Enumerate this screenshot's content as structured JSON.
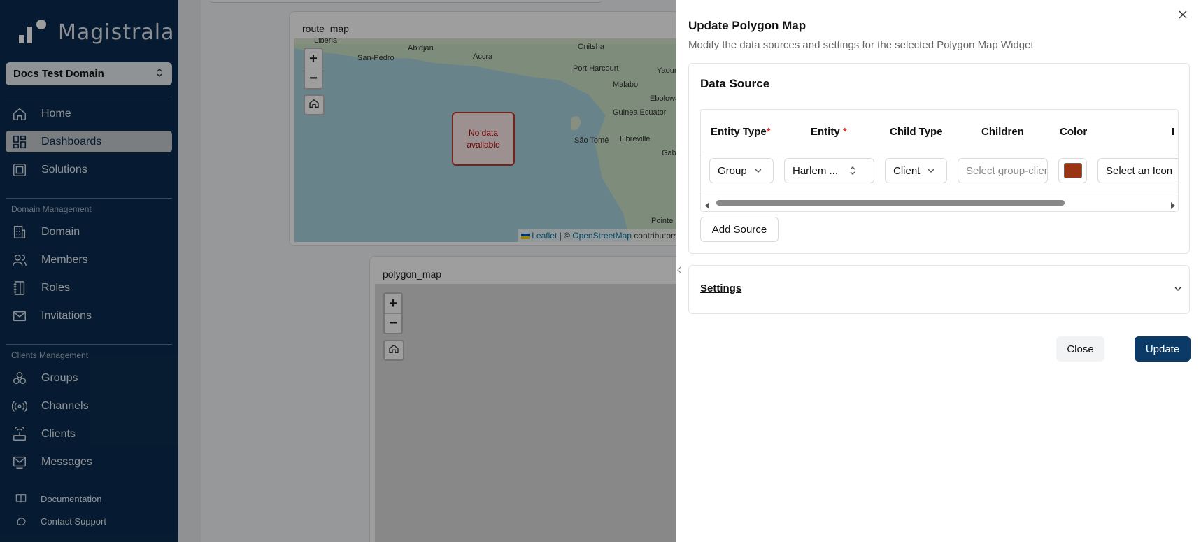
{
  "app": {
    "name": "Magistrala"
  },
  "sidebar": {
    "domain": "Docs Test Domain",
    "primary": [
      {
        "label": "Home",
        "icon": "home-icon",
        "active": false
      },
      {
        "label": "Dashboards",
        "icon": "dashboard-icon",
        "active": true
      },
      {
        "label": "Solutions",
        "icon": "solutions-icon",
        "active": false
      }
    ],
    "domain_section": "Domain Management",
    "domain_items": [
      {
        "label": "Domain",
        "icon": "building-icon"
      },
      {
        "label": "Members",
        "icon": "users-icon"
      },
      {
        "label": "Roles",
        "icon": "notebook-icon"
      },
      {
        "label": "Invitations",
        "icon": "mail-icon"
      }
    ],
    "clients_section": "Clients Management",
    "clients_items": [
      {
        "label": "Groups",
        "icon": "groups-icon"
      },
      {
        "label": "Channels",
        "icon": "radio-icon"
      },
      {
        "label": "Clients",
        "icon": "router-icon"
      },
      {
        "label": "Messages",
        "icon": "messages-icon"
      }
    ],
    "footer": [
      {
        "label": "Documentation",
        "icon": "book-icon"
      },
      {
        "label": "Contact Support",
        "icon": "chat-icon"
      }
    ]
  },
  "widgets": {
    "route_map": {
      "title": "route_map",
      "no_data": "No data available",
      "places": [
        "Liberia",
        "San-Pédro",
        "Abidjan",
        "Accra",
        "Onitsha",
        "Port Harcourt",
        "Yaoun",
        "Malabo",
        "Ebolowa",
        "Guinea Ecuator",
        "São Tomé",
        "Libreville",
        "Gabo",
        "Pointe"
      ],
      "attribution": {
        "leaflet": "Leaflet",
        "sep": " | © ",
        "osm": "OpenStreetMap",
        "suffix": " contributors"
      }
    },
    "polygon_map": {
      "title": "polygon_map"
    }
  },
  "panel": {
    "title": "Update Polygon Map",
    "subtitle": "Modify the data sources and settings for the selected Polygon Map Widget",
    "data_source": {
      "heading": "Data Source",
      "columns": {
        "entity_type": "Entity Type",
        "entity": "Entity",
        "child_type": "Child Type",
        "children": "Children",
        "color": "Color",
        "icon_col": "I"
      },
      "row": {
        "entity_type": "Group",
        "entity": "Harlem ...",
        "child_type": "Client",
        "children_placeholder": "Select group-clients",
        "color": "#9a3412",
        "icon": "Select an Icon"
      },
      "add_source": "Add Source"
    },
    "settings": {
      "heading": "Settings"
    },
    "buttons": {
      "close": "Close",
      "update": "Update"
    }
  }
}
